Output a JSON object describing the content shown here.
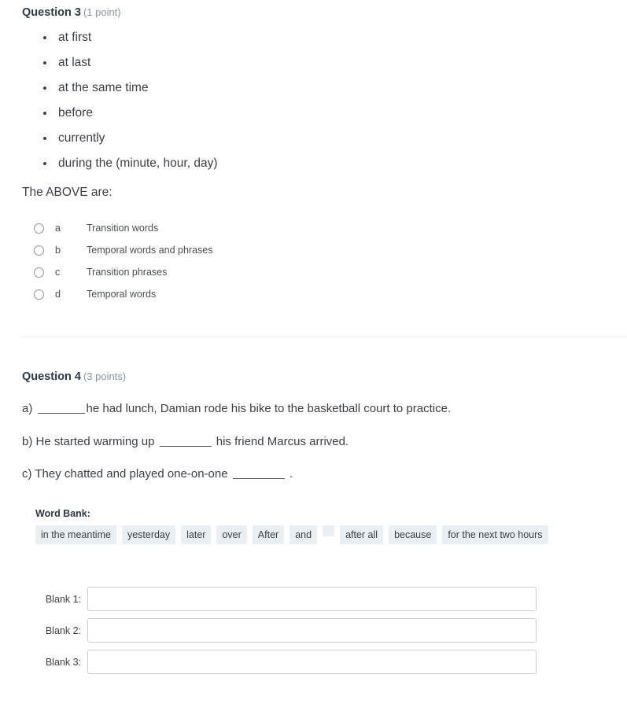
{
  "question3": {
    "title": "Question 3",
    "points": "(1 point)",
    "stem_items": [
      "at first",
      "at last",
      "at the same time",
      "before",
      "currently",
      "during the (minute, hour, day)"
    ],
    "prompt": "The ABOVE are:",
    "options": [
      {
        "letter": "a",
        "text": "Transition words"
      },
      {
        "letter": "b",
        "text": "Temporal words and phrases"
      },
      {
        "letter": "c",
        "text": "Transition phrases"
      },
      {
        "letter": "d",
        "text": "Temporal words"
      }
    ]
  },
  "question4": {
    "title": "Question 4",
    "points": "(3 points)",
    "sentences": {
      "a_prefix": "a)",
      "a_suffix": "he had lunch, Damian rode his bike to the basketball court to practice.",
      "b_prefix": "b) He started warming up",
      "b_suffix": "his friend Marcus arrived.",
      "c_prefix": "c) They chatted and played one-on-one",
      "c_suffix": "."
    },
    "wordbank": {
      "label": "Word Bank:",
      "chips": [
        "in the meantime",
        "yesterday",
        "later",
        "over",
        "After",
        "and",
        "",
        "after all",
        "because",
        "for the next two hours"
      ]
    },
    "blanks": [
      {
        "label": "Blank 1:",
        "value": "",
        "placeholder": ""
      },
      {
        "label": "Blank 2:",
        "value": "",
        "placeholder": ""
      },
      {
        "label": "Blank 3:",
        "value": "",
        "placeholder": ""
      }
    ]
  }
}
